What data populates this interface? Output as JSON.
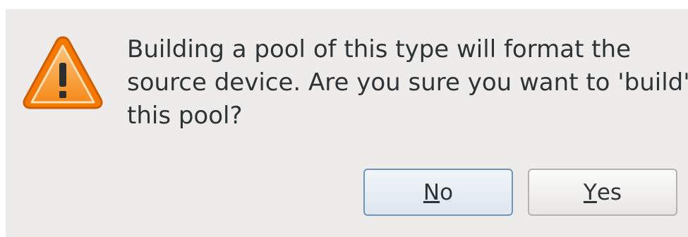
{
  "dialog": {
    "message_lines": [
      "Building a pool of this type will format the",
      "source device. Are you sure you want to 'build'",
      "this pool?"
    ],
    "icon": "warning-icon",
    "buttons": {
      "no": {
        "mnemonic": "N",
        "rest": "o"
      },
      "yes": {
        "mnemonic": "Y",
        "rest": "es"
      }
    }
  },
  "colors": {
    "dialog_background": "#edeceb",
    "warning_orange": "#f57900",
    "warning_fill": "#fcaf3e",
    "text": "#2e3436",
    "focus_border": "#7195b9"
  }
}
